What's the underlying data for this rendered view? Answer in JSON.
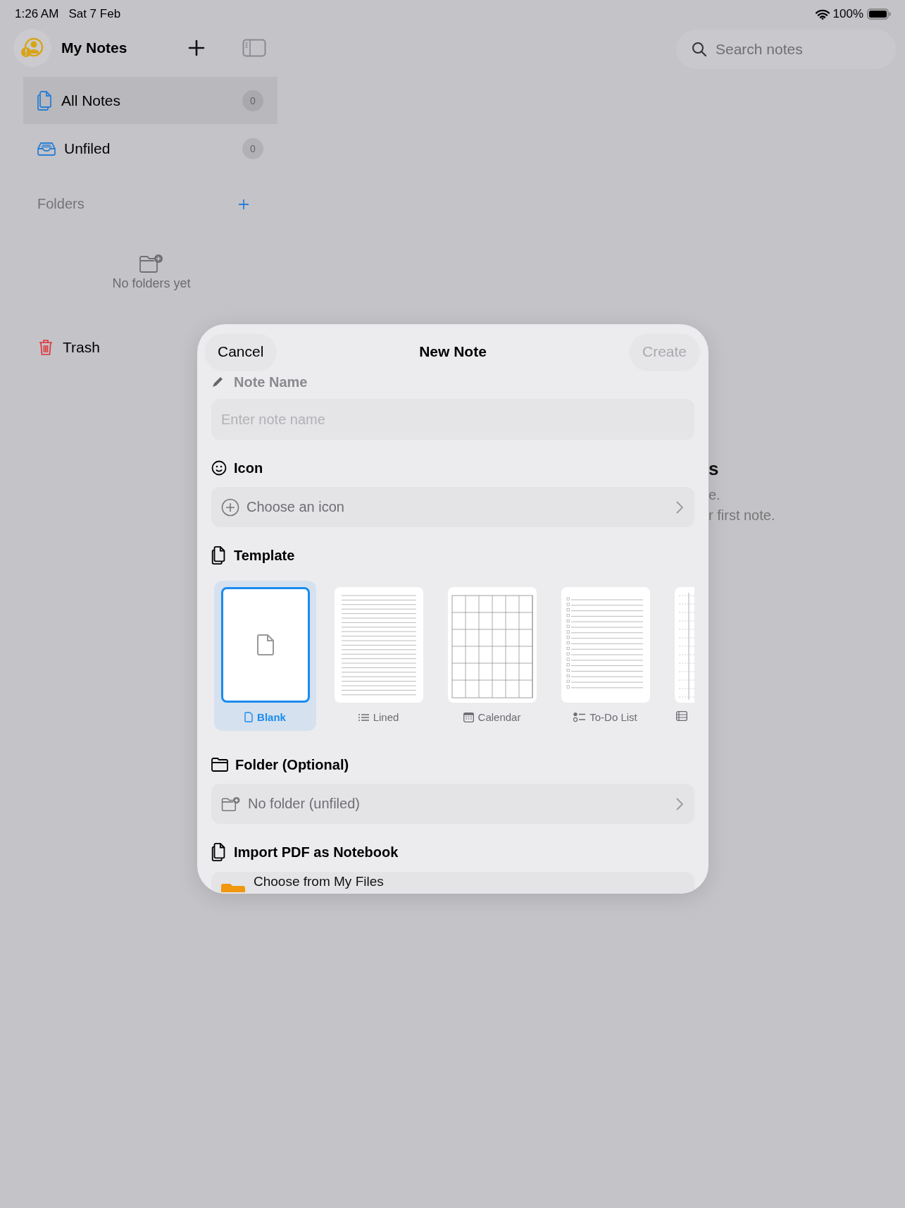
{
  "status_bar": {
    "time": "1:26 AM",
    "date": "Sat 7 Feb",
    "battery": "100%"
  },
  "sidebar": {
    "title": "My Notes",
    "items": [
      {
        "label": "All Notes",
        "count": "0",
        "selected": true,
        "kind": "all"
      },
      {
        "label": "Unfiled",
        "count": "0",
        "selected": false,
        "kind": "unfiled"
      }
    ],
    "folders_heading": "Folders",
    "empty_text": "No folders yet",
    "trash": "Trash"
  },
  "search": {
    "placeholder": "Search notes"
  },
  "background_texts": [
    {
      "text": "s",
      "kind": "heading"
    },
    {
      "text": "e.",
      "kind": "body"
    },
    {
      "text": "r first note.",
      "kind": "body"
    }
  ],
  "dialog": {
    "cancel": "Cancel",
    "title": "New Note",
    "create": {
      "label": "Create",
      "disabled": true
    },
    "name_label": "Note Name",
    "name_placeholder": "Enter note name",
    "icon_heading": "Icon",
    "icon_choice": "Choose an icon",
    "template_heading": "Template",
    "templates": [
      {
        "label": "Blank",
        "kind": "blank",
        "selected": true
      },
      {
        "label": "Lined",
        "kind": "lined",
        "selected": false
      },
      {
        "label": "Calendar",
        "kind": "calendar",
        "selected": false
      },
      {
        "label": "To-Do List",
        "kind": "todo",
        "selected": false
      },
      {
        "kind": "columns",
        "selected": false
      }
    ],
    "folder_heading": "Folder (Optional)",
    "folder_choice": "No folder (unfiled)",
    "import_heading": "Import PDF as Notebook",
    "import_choice": "Choose from My Files"
  }
}
